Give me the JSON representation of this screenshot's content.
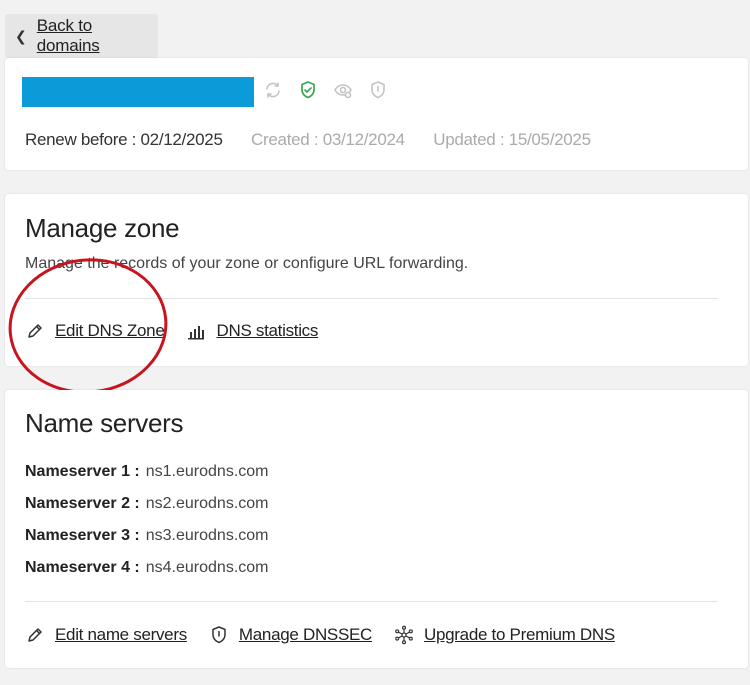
{
  "back_button": {
    "label": "Back to domains",
    "icon": "chevron-left-icon"
  },
  "domain": {
    "redacted_color": "#0a9bd8",
    "status_icons": [
      "refresh-icon",
      "shield-check-icon",
      "eye-icon",
      "shield-icon"
    ],
    "status_colors": {
      "active": "#3aa655",
      "inactive": "#c4c4c4"
    },
    "renew_label": "Renew before : 02/12/2025",
    "created_label": "Created : 03/12/2024",
    "updated_label": "Updated : 15/05/2025"
  },
  "manage_zone": {
    "title": "Manage zone",
    "description": "Manage the records of your zone or configure URL forwarding.",
    "actions": [
      {
        "label": "Edit DNS Zone",
        "icon": "pencil-icon"
      },
      {
        "label": "DNS statistics",
        "icon": "bar-chart-icon"
      }
    ],
    "annotation_color": "#c8141e"
  },
  "name_servers": {
    "title": "Name servers",
    "items": [
      {
        "label": "Nameserver 1 :",
        "value": "ns1.eurodns.com"
      },
      {
        "label": "Nameserver 2 :",
        "value": "ns2.eurodns.com"
      },
      {
        "label": "Nameserver 3 :",
        "value": "ns3.eurodns.com"
      },
      {
        "label": "Nameserver 4 :",
        "value": "ns4.eurodns.com"
      }
    ],
    "actions": [
      {
        "label": "Edit name servers",
        "icon": "pencil-icon"
      },
      {
        "label": "Manage DNSSEC",
        "icon": "shield-icon"
      },
      {
        "label": "Upgrade to Premium DNS",
        "icon": "network-icon"
      }
    ]
  }
}
